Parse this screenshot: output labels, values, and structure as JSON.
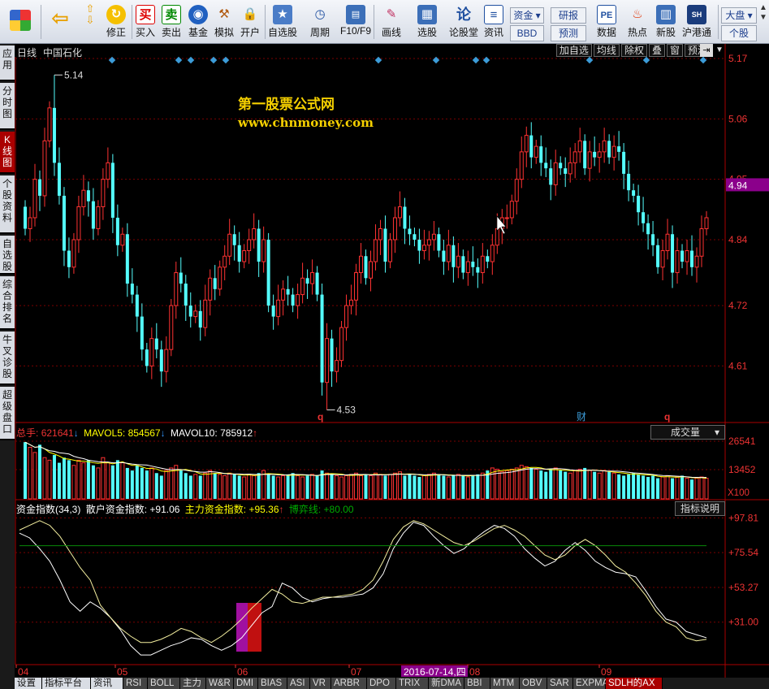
{
  "toolbar": {
    "buttons": [
      {
        "label": "",
        "icon": "windows-icon"
      },
      {
        "label": "",
        "icon": "back-arrow-icon"
      },
      {
        "label": "修正",
        "icon": "up-down-icon"
      },
      {
        "label": "修正",
        "icon": "refresh-icon"
      },
      {
        "label": "买入",
        "icon": "buy-icon",
        "glyph": "买"
      },
      {
        "label": "卖出",
        "icon": "sell-icon",
        "glyph": "卖"
      },
      {
        "label": "基金",
        "icon": "fund-icon"
      },
      {
        "label": "模拟",
        "icon": "hammer-icon"
      },
      {
        "label": "开户",
        "icon": "lock-icon"
      },
      {
        "label": "自选股",
        "icon": "star-icon"
      },
      {
        "label": "周期",
        "icon": "clock-icon"
      },
      {
        "label": "F10/F9",
        "icon": "f10-icon"
      },
      {
        "label": "画线",
        "icon": "pencil-icon"
      },
      {
        "label": "选股",
        "icon": "select-stock-icon"
      },
      {
        "label": "论股堂",
        "icon": "forum-icon",
        "glyph": "论"
      },
      {
        "label": "资讯",
        "icon": "news-icon"
      },
      {
        "label": "数据",
        "icon": "pe-icon",
        "glyph": "PE"
      },
      {
        "label": "热点",
        "icon": "hot-icon"
      },
      {
        "label": "新股",
        "icon": "new-stock-icon"
      },
      {
        "label": "沪港通",
        "icon": "hk-connect-icon"
      }
    ],
    "box_zijin": "资金",
    "box_bbd": "BBD",
    "box_yanbao": "研报",
    "box_yuce": "预测",
    "box_dapan": "大盘",
    "box_gegu": "个股"
  },
  "sidebar": {
    "tabs": [
      "应用",
      "分时图",
      "K线图",
      "个股资料",
      "自选股",
      "综合排名",
      "牛叉诊股",
      "超级盘口"
    ]
  },
  "chart_header": {
    "period": "日线",
    "stock_name": "中国石化",
    "buttons": [
      "加自选",
      "均线",
      "除权",
      "叠",
      "窗",
      "预测"
    ]
  },
  "watermark": {
    "title": "第一股票公式网",
    "url": "www.chnmoney.com"
  },
  "volume_panel": {
    "label_total": "总手:",
    "total_value": "621641",
    "label_mavol5": "MAVOL5:",
    "mavol5_value": "854567",
    "label_mavol10": "MAVOL10:",
    "mavol10_value": "785912",
    "dropdown_label": "成交量",
    "scale_label": "X100"
  },
  "indicator_panel": {
    "name": "资金指数(34,3)",
    "label_retail": "散户资金指数:",
    "retail_value": "+91.06",
    "label_main": "主力资金指数:",
    "main_value": "+95.36",
    "label_game": "博弈线:",
    "game_value": "+80.00",
    "explain_button": "指标说明"
  },
  "bottom_tabs": [
    "设置",
    "指标平台",
    "资讯",
    "RSI",
    "BOLL",
    "主力",
    "W&R",
    "DMI",
    "BIAS",
    "ASI",
    "VR",
    "ARBR",
    "DPO",
    "TRIX",
    "新DMA",
    "BBI",
    "MTM",
    "OBV",
    "SAR",
    "EXPMA",
    "SDLH的AX"
  ],
  "chart_data": [
    {
      "type": "candlestick",
      "series": [
        {
          "name": "中国石化",
          "open": [
            4.9,
            4.86,
            4.88,
            4.95,
            4.92,
            5.02,
            5.08,
            4.98,
            4.92,
            4.82,
            4.79,
            4.84,
            4.9,
            4.93,
            4.91,
            4.86,
            4.9,
            4.95,
            4.98,
            4.88,
            4.83,
            4.85,
            4.76,
            4.74,
            4.7,
            4.64,
            4.61,
            4.66,
            4.64,
            4.6,
            4.64,
            4.72,
            4.78,
            4.76,
            4.72,
            4.7,
            4.71,
            4.68,
            4.73,
            4.77,
            4.75,
            4.79,
            4.81,
            4.85,
            4.83,
            4.8,
            4.82,
            4.84,
            4.86,
            4.8,
            4.84,
            4.72,
            4.7,
            4.73,
            4.75,
            4.74,
            4.72,
            4.74,
            4.77,
            4.76,
            4.78,
            4.74,
            4.58,
            4.66,
            4.6,
            4.62,
            4.68,
            4.72,
            4.73,
            4.78,
            4.81,
            4.77,
            4.8,
            4.84,
            4.86,
            4.8,
            4.84,
            4.88,
            4.9,
            4.86,
            4.85,
            4.84,
            4.82,
            4.83,
            4.84,
            4.85,
            4.82,
            4.8,
            4.83,
            4.79,
            4.81,
            4.78,
            4.8,
            4.79,
            4.78,
            4.81,
            4.8,
            4.83,
            4.86,
            4.88,
            4.88,
            4.91,
            4.95,
            5.0,
            5.03,
            4.99,
            5.01,
            4.98,
            4.97,
            4.94,
            4.98,
            4.97,
            4.96,
            4.98,
            5.0,
            5.02,
            4.97,
            5.0,
            4.99,
            5.0,
            5.02,
            4.99,
            5.01,
            5.0,
            4.96,
            4.93,
            4.92,
            4.89,
            4.87,
            4.85,
            4.83,
            4.79,
            4.82,
            4.85,
            4.78,
            4.82,
            4.8,
            4.82,
            4.79,
            4.81,
            4.86
          ],
          "close": [
            4.86,
            4.88,
            4.95,
            4.92,
            5.02,
            5.08,
            4.98,
            4.92,
            4.82,
            4.79,
            4.84,
            4.9,
            4.93,
            4.91,
            4.86,
            4.9,
            4.95,
            4.98,
            4.88,
            4.83,
            4.85,
            4.76,
            4.74,
            4.7,
            4.64,
            4.61,
            4.66,
            4.64,
            4.6,
            4.64,
            4.72,
            4.78,
            4.76,
            4.72,
            4.7,
            4.71,
            4.68,
            4.73,
            4.77,
            4.75,
            4.79,
            4.81,
            4.85,
            4.83,
            4.8,
            4.82,
            4.84,
            4.86,
            4.8,
            4.84,
            4.72,
            4.7,
            4.73,
            4.75,
            4.74,
            4.72,
            4.74,
            4.77,
            4.76,
            4.78,
            4.74,
            4.58,
            4.66,
            4.6,
            4.62,
            4.68,
            4.72,
            4.73,
            4.78,
            4.81,
            4.77,
            4.8,
            4.84,
            4.86,
            4.8,
            4.84,
            4.88,
            4.9,
            4.86,
            4.85,
            4.84,
            4.82,
            4.83,
            4.84,
            4.85,
            4.82,
            4.8,
            4.83,
            4.79,
            4.81,
            4.78,
            4.8,
            4.79,
            4.78,
            4.81,
            4.8,
            4.83,
            4.86,
            4.88,
            4.88,
            4.91,
            4.95,
            5.0,
            5.03,
            4.99,
            5.01,
            4.98,
            4.97,
            4.94,
            4.98,
            4.97,
            4.96,
            4.98,
            5.0,
            5.02,
            4.97,
            5.0,
            4.99,
            5.0,
            5.02,
            4.99,
            5.01,
            5.0,
            4.96,
            4.93,
            4.92,
            4.89,
            4.87,
            4.85,
            4.83,
            4.79,
            4.82,
            4.85,
            4.78,
            4.82,
            4.8,
            4.82,
            4.79,
            4.81,
            4.86,
            4.88
          ]
        }
      ],
      "ylim": [
        4.51,
        5.17
      ],
      "yticks": [
        "5.17",
        "5.06",
        "4.95",
        "4.84",
        "4.72",
        "4.61"
      ],
      "last_price": "4.94",
      "annotations": [
        "5.14",
        "4.53"
      ],
      "markers": [
        "q",
        "财",
        "q"
      ],
      "xticks": [
        "04",
        "05",
        "06",
        "07",
        "08",
        "09"
      ],
      "selected_date": "2016-07-14,四"
    },
    {
      "type": "bar",
      "ylim": [
        0,
        26541
      ],
      "yticks": [
        "26541",
        "13452"
      ],
      "values": [
        220,
        200,
        180,
        210,
        160,
        150,
        170,
        140,
        160,
        150,
        130,
        150,
        140,
        150,
        130,
        120,
        160,
        140,
        130,
        150,
        140,
        120,
        110,
        130,
        120,
        110,
        120,
        100,
        90,
        110,
        120,
        130,
        110,
        100,
        90,
        95,
        90,
        100,
        110,
        100,
        95,
        90,
        100,
        95,
        90,
        85,
        95,
        90,
        100,
        110,
        95,
        90,
        85,
        90,
        95,
        100,
        90,
        85,
        90,
        95,
        90,
        110,
        100,
        95,
        90,
        85,
        90,
        95,
        100,
        90,
        95,
        90,
        100,
        95,
        90,
        95,
        100,
        105,
        90,
        95,
        90,
        85,
        90,
        95,
        100,
        95,
        90,
        85,
        90,
        95,
        90,
        85,
        90,
        95,
        100,
        110,
        120,
        115,
        105,
        110,
        115,
        120,
        130,
        125,
        120,
        115,
        110,
        105,
        115,
        120,
        110,
        105,
        100,
        110,
        115,
        120,
        110,
        105,
        100,
        110,
        105,
        100,
        95,
        90,
        95,
        100,
        95,
        90,
        85,
        90,
        80,
        85,
        90,
        80,
        85,
        90,
        80,
        75,
        80,
        85,
        80
      ]
    },
    {
      "type": "line",
      "ylim": [
        9,
        98
      ],
      "yticks": [
        "+97.81",
        "+75.54",
        "+53.27",
        "+31.00"
      ],
      "series": [
        {
          "name": "散户资金指数",
          "values": [
            88,
            85,
            78,
            70,
            58,
            44,
            38,
            44,
            40,
            34,
            26,
            16,
            10,
            10,
            13,
            16,
            18,
            21,
            20,
            16,
            13,
            16,
            21,
            29,
            37,
            41,
            56,
            53,
            47,
            44,
            46,
            47,
            47,
            48,
            49,
            53,
            62,
            78,
            88,
            95,
            93,
            86,
            80,
            75,
            78,
            84,
            89,
            93,
            91,
            86,
            78,
            72,
            67,
            70,
            77,
            82,
            77,
            70,
            66,
            63,
            62,
            60,
            51,
            41,
            33,
            31,
            25,
            23,
            21
          ]
        },
        {
          "name": "主力资金指数",
          "values": [
            90,
            93,
            96,
            93,
            86,
            76,
            66,
            58,
            42,
            34,
            27,
            22,
            18,
            18,
            20,
            23,
            27,
            25,
            21,
            18,
            22,
            27,
            33,
            40,
            46,
            52,
            49,
            44,
            43,
            45,
            47,
            47,
            48,
            49,
            52,
            58,
            70,
            84,
            92,
            96,
            94,
            90,
            86,
            82,
            80,
            83,
            87,
            91,
            93,
            90,
            86,
            80,
            74,
            71,
            74,
            80,
            84,
            80,
            74,
            67,
            63,
            56,
            48,
            38,
            31,
            28,
            21,
            19,
            20
          ]
        },
        {
          "name": "博弈线",
          "values": [
            80,
            80,
            80,
            80,
            80,
            80,
            80,
            80,
            80,
            80,
            80,
            80,
            80,
            80,
            80,
            80,
            80,
            80,
            80,
            80,
            80,
            80,
            80,
            80,
            80,
            80,
            80,
            80,
            80,
            80,
            80,
            80,
            80,
            80,
            80,
            80,
            80,
            80,
            80,
            80,
            80,
            80,
            80,
            80,
            80,
            80,
            80,
            80,
            80,
            80,
            80,
            80,
            80,
            80,
            80,
            80,
            80,
            80,
            80,
            80,
            80,
            80,
            80,
            80,
            80,
            80,
            80,
            80,
            80
          ]
        }
      ]
    }
  ]
}
